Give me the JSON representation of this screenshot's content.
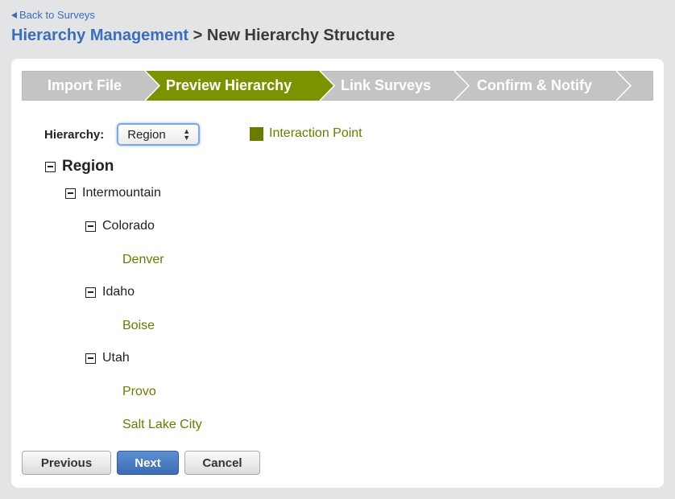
{
  "nav": {
    "back_label": "Back to Surveys"
  },
  "header": {
    "crumb": "Hierarchy Management",
    "separator": " > ",
    "page": "New Hierarchy Structure"
  },
  "wizard": {
    "steps": [
      {
        "label": "Import File",
        "state": "inactive"
      },
      {
        "label": "Preview Hierarchy",
        "state": "active"
      },
      {
        "label": "Link Surveys",
        "state": "inactive"
      },
      {
        "label": "Confirm & Notify",
        "state": "inactive"
      }
    ],
    "active_color": "#7d9200",
    "inactive_color": "#c4c4c4"
  },
  "hierarchy": {
    "label": "Hierarchy:",
    "selected": "Region"
  },
  "legend": {
    "label": "Interaction Point",
    "color": "#6b7a00"
  },
  "tree": {
    "root": "Region",
    "group": "Intermountain",
    "states": [
      {
        "name": "Colorado",
        "cities": [
          "Denver"
        ]
      },
      {
        "name": "Idaho",
        "cities": [
          "Boise"
        ]
      },
      {
        "name": "Utah",
        "cities": [
          "Provo",
          "Salt Lake City"
        ]
      }
    ]
  },
  "actions": {
    "previous": "Previous",
    "next": "Next",
    "cancel": "Cancel"
  }
}
